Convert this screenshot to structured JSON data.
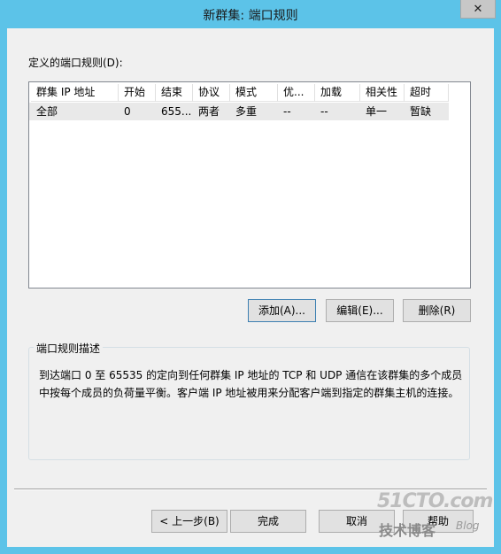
{
  "window": {
    "title": "新群集: 端口规则",
    "close_glyph": "✕"
  },
  "list": {
    "label": "定义的端口规则(D):",
    "columns": [
      "群集 IP 地址",
      "开始",
      "结束",
      "协议",
      "模式",
      "优...",
      "加载",
      "相关性",
      "超时"
    ],
    "rows": [
      [
        "全部",
        "0",
        "655...",
        "两者",
        "多重",
        "--",
        "--",
        "单一",
        "暂缺"
      ]
    ]
  },
  "buttons": {
    "add": "添加(A)...",
    "edit": "编辑(E)...",
    "delete": "删除(R)"
  },
  "description": {
    "title": "端口规则描述",
    "text": "到达端口 0 至 65535 的定向到任何群集 IP 地址的 TCP 和 UDP 通信在该群集的多个成员中按每个成员的负荷量平衡。客户端 IP 地址被用来分配客户端到指定的群集主机的连接。"
  },
  "footer": {
    "back": "< 上一步(B)",
    "finish": "完成",
    "cancel": "取消",
    "help": "帮助"
  },
  "watermark": {
    "logo": "51CTO.com",
    "sub": "技术博客",
    "blog": "Blog"
  }
}
